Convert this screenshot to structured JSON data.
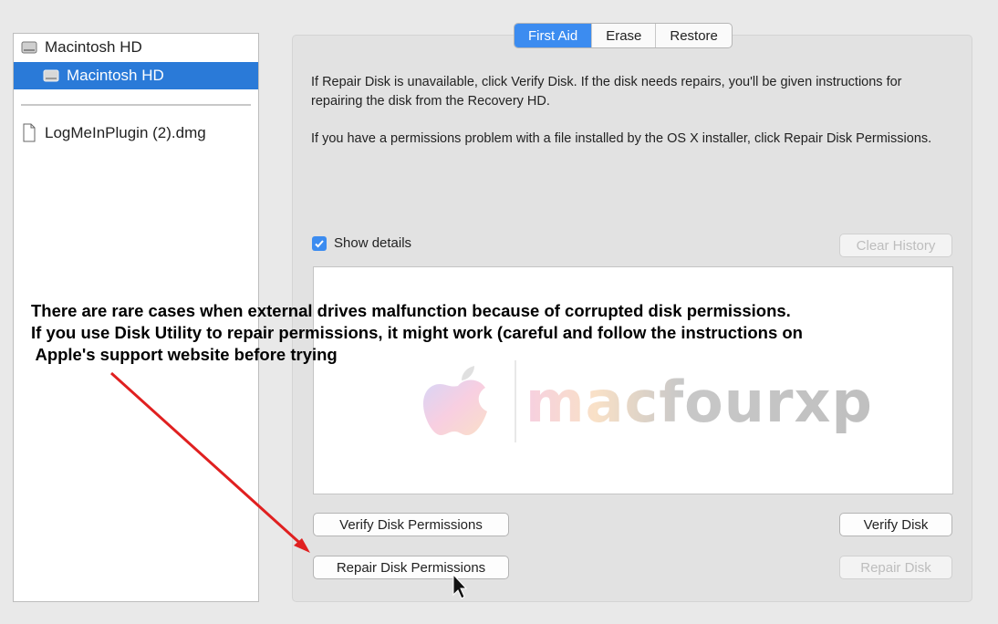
{
  "sidebar": {
    "items": [
      {
        "label": "Macintosh HD",
        "icon": "hard-drive-icon"
      },
      {
        "label": "Macintosh HD",
        "icon": "volume-icon",
        "selected": true
      },
      {
        "label": "LogMeInPlugin (2).dmg",
        "icon": "disk-image-icon"
      }
    ]
  },
  "tabs": [
    {
      "label": "First Aid",
      "active": true
    },
    {
      "label": "Erase"
    },
    {
      "label": "Restore"
    }
  ],
  "first_aid": {
    "info_1": "If Repair Disk is unavailable, click Verify Disk. If the disk needs repairs, you'll be given instructions for repairing the disk from the Recovery HD.",
    "info_2": "If you have a permissions problem with a file installed by the OS X installer, click Repair Disk Permissions.",
    "show_details_label": "Show details",
    "show_details_checked": true,
    "clear_history_label": "Clear History",
    "verify_permissions_label": "Verify Disk Permissions",
    "repair_permissions_label": "Repair Disk Permissions",
    "verify_disk_label": "Verify Disk",
    "repair_disk_label": "Repair Disk"
  },
  "watermark": {
    "text": "macfourxp"
  },
  "annotation": {
    "line_1": "There are rare cases when external drives malfunction because of corrupted disk permissions.",
    "line_2": "If you use Disk Utility to repair permissions, it might work (careful and follow the instructions on",
    "line_3": " Apple's support website before trying"
  },
  "colors": {
    "accent": "#3c8cf0",
    "selection": "#2a7ad8",
    "arrow": "#e02020"
  }
}
